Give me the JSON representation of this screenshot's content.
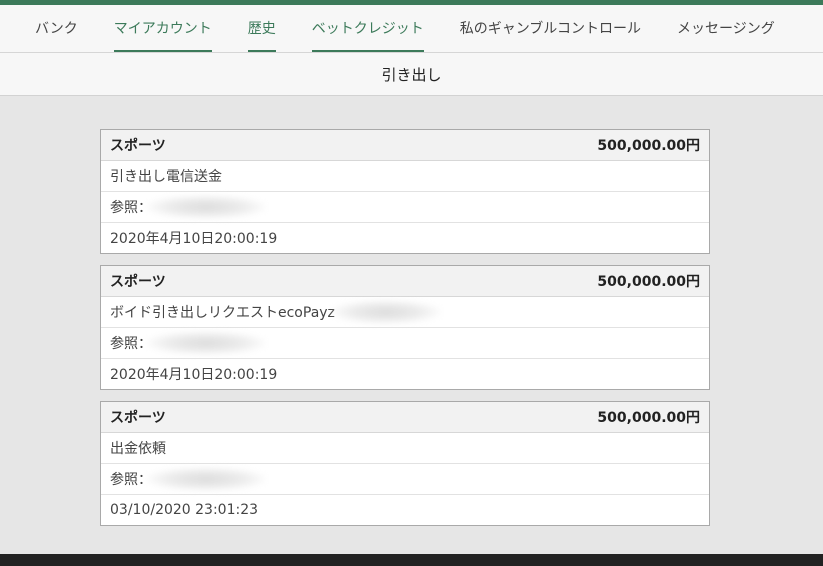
{
  "nav": {
    "items": [
      {
        "label": "バンク",
        "active": false
      },
      {
        "label": "マイアカウント",
        "active": true
      },
      {
        "label": "歴史",
        "active": true
      },
      {
        "label": "ベットクレジット",
        "active": true
      },
      {
        "label": "私のギャンブルコントロール",
        "active": false
      },
      {
        "label": "メッセージング",
        "active": false
      }
    ]
  },
  "page": {
    "title": "引き出し"
  },
  "transactions": [
    {
      "category": "スポーツ",
      "amount": "500,000.00円",
      "description": "引き出し電信送金",
      "reference_label": "参照：",
      "datetime": "2020年4月10日20:00:19"
    },
    {
      "category": "スポーツ",
      "amount": "500,000.00円",
      "description": "ボイド引き出しリクエストecoPayz",
      "reference_label": "参照：",
      "datetime": "2020年4月10日20:00:19"
    },
    {
      "category": "スポーツ",
      "amount": "500,000.00円",
      "description": "出金依頼",
      "reference_label": "参照：",
      "datetime": "03/10/2020 23:01:23"
    }
  ],
  "colors": {
    "accent": "#3c7a5a",
    "background": "#e6e6e6"
  }
}
